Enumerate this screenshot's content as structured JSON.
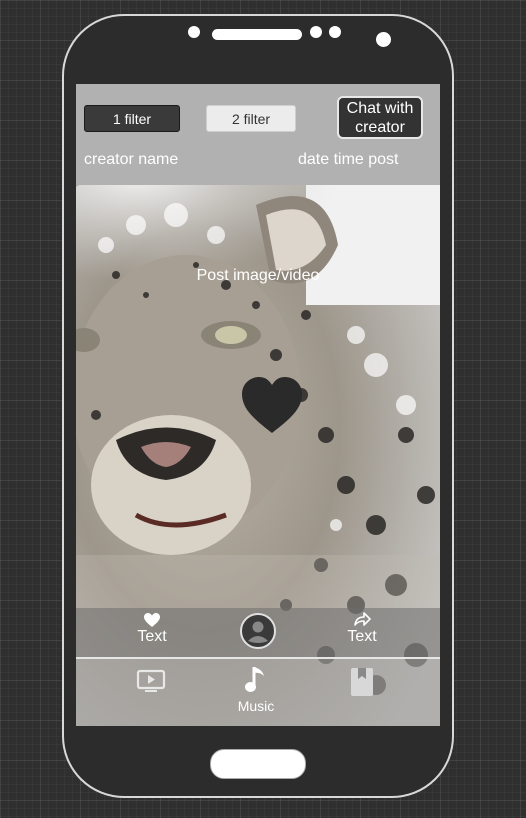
{
  "header": {
    "filter1_label": "1 filter",
    "filter2_label": "2 filter",
    "chat_label": "Chat with creator",
    "creator_name": "creator name",
    "date_time": "date time post"
  },
  "post": {
    "placeholder": "Post image/video",
    "like_icon": "heart-icon"
  },
  "actions": {
    "like_label": "Text",
    "share_label": "Text",
    "avatar_icon": "user-avatar-icon"
  },
  "bottom_nav": {
    "video_icon": "tv-play-icon",
    "music_icon": "music-note-icon",
    "music_label": "Music",
    "bookmark_icon": "bookmark-icon"
  },
  "colors": {
    "phone_body": "#2c2c2c",
    "screen_header": "#b1b1b1",
    "dark_button": "#3a3a3a"
  }
}
